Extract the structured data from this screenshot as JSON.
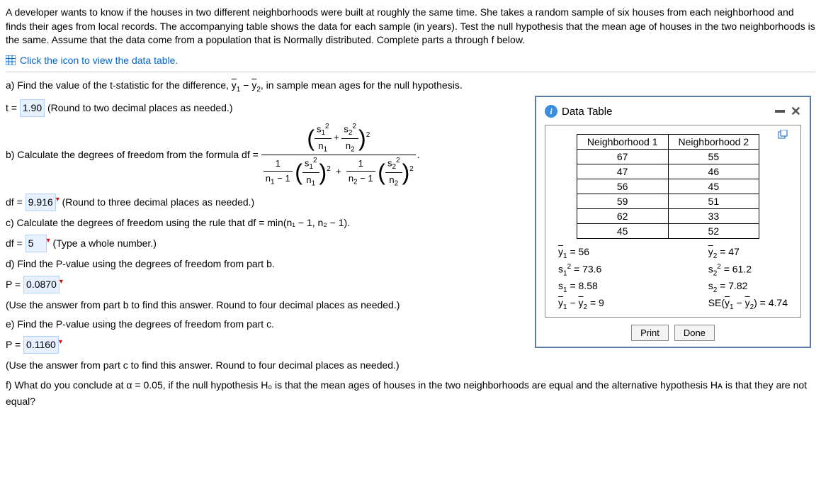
{
  "intro": "A developer wants to know if the houses in two different neighborhoods were built at roughly the same time. She takes a random sample of six houses from each neighborhood and finds their ages from local records. The accompanying table shows the data for each sample (in years). Test the null hypothesis that the mean age of houses in the two neighborhoods is the same. Assume that the data come from a population that is Normally distributed. Complete parts a through f below.",
  "data_link": "Click the icon to view the data table.",
  "parts": {
    "a_prompt": "a) Find the value of the t-statistic for the difference, ",
    "a_prompt_end": ", in sample mean ages for the null hypothesis.",
    "a_t_label": "t = ",
    "a_t_value": "1.90",
    "a_note": " (Round to two decimal places as needed.)",
    "b_prompt": "b) Calculate the degrees of freedom from the formula df = ",
    "b_df_label": "df = ",
    "b_df_value": "9.916",
    "b_note": " (Round to three decimal places as needed.)",
    "c_prompt": "c) Calculate the degrees of freedom using the rule that df = min(n₁ − 1, n₂ − 1).",
    "c_df_label": "df = ",
    "c_df_value": "5",
    "c_note": " (Type a whole number.)",
    "d_prompt": "d) Find the P-value using the degrees of freedom from part b.",
    "d_p_label": "P = ",
    "d_p_value": "0.0870",
    "d_note": "(Use the answer from part b to find this answer. Round to four decimal places as needed.)",
    "e_prompt": "e) Find the P-value using the degrees of freedom from part c.",
    "e_p_label": "P = ",
    "e_p_value": "0.1160",
    "e_note": "(Use the answer from part c to find this answer. Round to four decimal places as needed.)",
    "f_prompt": "f) What do you conclude at α = 0.05, if the null hypothesis H₀ is that the mean ages of houses in the two neighborhoods are equal and the alternative hypothesis Hᴀ is that they are not equal?"
  },
  "ybar_diff_expr": "y̅₁ − y̅₂",
  "dialog": {
    "title": "Data Table",
    "headers": [
      "Neighborhood 1",
      "Neighborhood 2"
    ],
    "rows": [
      [
        "67",
        "55"
      ],
      [
        "47",
        "46"
      ],
      [
        "56",
        "45"
      ],
      [
        "59",
        "51"
      ],
      [
        "62",
        "33"
      ],
      [
        "45",
        "52"
      ]
    ],
    "stats_left": [
      "y̅₁ = 56",
      "s₁² = 73.6",
      "s₁ = 8.58",
      "y̅₁ − y̅₂ = 9"
    ],
    "stats_right": [
      "y̅₂ = 47",
      "s₂² = 61.2",
      "s₂ = 7.82",
      "SE(y̅₁ − y̅₂) = 4.74"
    ],
    "print": "Print",
    "done": "Done"
  },
  "chart_data": {
    "type": "table",
    "title": "Data Table",
    "columns": [
      "Neighborhood 1",
      "Neighborhood 2"
    ],
    "data": [
      [
        67,
        55
      ],
      [
        47,
        46
      ],
      [
        56,
        45
      ],
      [
        59,
        51
      ],
      [
        62,
        33
      ],
      [
        45,
        52
      ]
    ],
    "summary": {
      "ybar1": 56,
      "ybar2": 47,
      "s1_sq": 73.6,
      "s2_sq": 61.2,
      "s1": 8.58,
      "s2": 7.82,
      "diff_means": 9,
      "se_diff": 4.74
    }
  }
}
